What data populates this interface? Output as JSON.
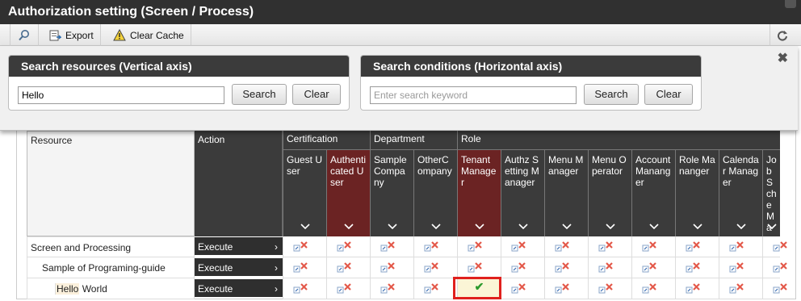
{
  "window": {
    "title": "Authorization setting (Screen / Process)"
  },
  "toolbar": {
    "export_label": "Export",
    "clear_cache_label": "Clear Cache"
  },
  "search_resources": {
    "title": "Search resources (Vertical axis)",
    "value": "Hello",
    "search_label": "Search",
    "clear_label": "Clear"
  },
  "search_conditions": {
    "title": "Search conditions (Horizontal axis)",
    "placeholder": "Enter search keyword",
    "search_label": "Search",
    "clear_label": "Clear"
  },
  "grid": {
    "resource_header": "Resource",
    "action_header": "Action",
    "groups": [
      "Certification",
      "Department",
      "Role"
    ],
    "columns": [
      "Guest User",
      "Authenticated User",
      "SampleCompany",
      "OtherCompany",
      "TenantManager",
      "Authz Setting Manager",
      "Menu Manager",
      "Menu Operator",
      "Account Mananger",
      "Role Mananger",
      "Calendar Manager",
      "JobScheMan"
    ],
    "rows": [
      {
        "resource": "Screen and Processing",
        "action": "Execute"
      },
      {
        "resource": "Sample of Programing-guide",
        "action": "Execute"
      },
      {
        "resource_highlight": "Hello",
        "resource_rest": " World",
        "action": "Execute"
      }
    ],
    "icons": {
      "denied": "deny-icon",
      "granted": "check-icon",
      "chevron": "chevron-down-icon"
    },
    "colors": {
      "header": "#3b3b3b",
      "highlight_column": "#6b2323",
      "selection_border": "#e0201d",
      "granted_check": "#2d9a2d"
    }
  }
}
